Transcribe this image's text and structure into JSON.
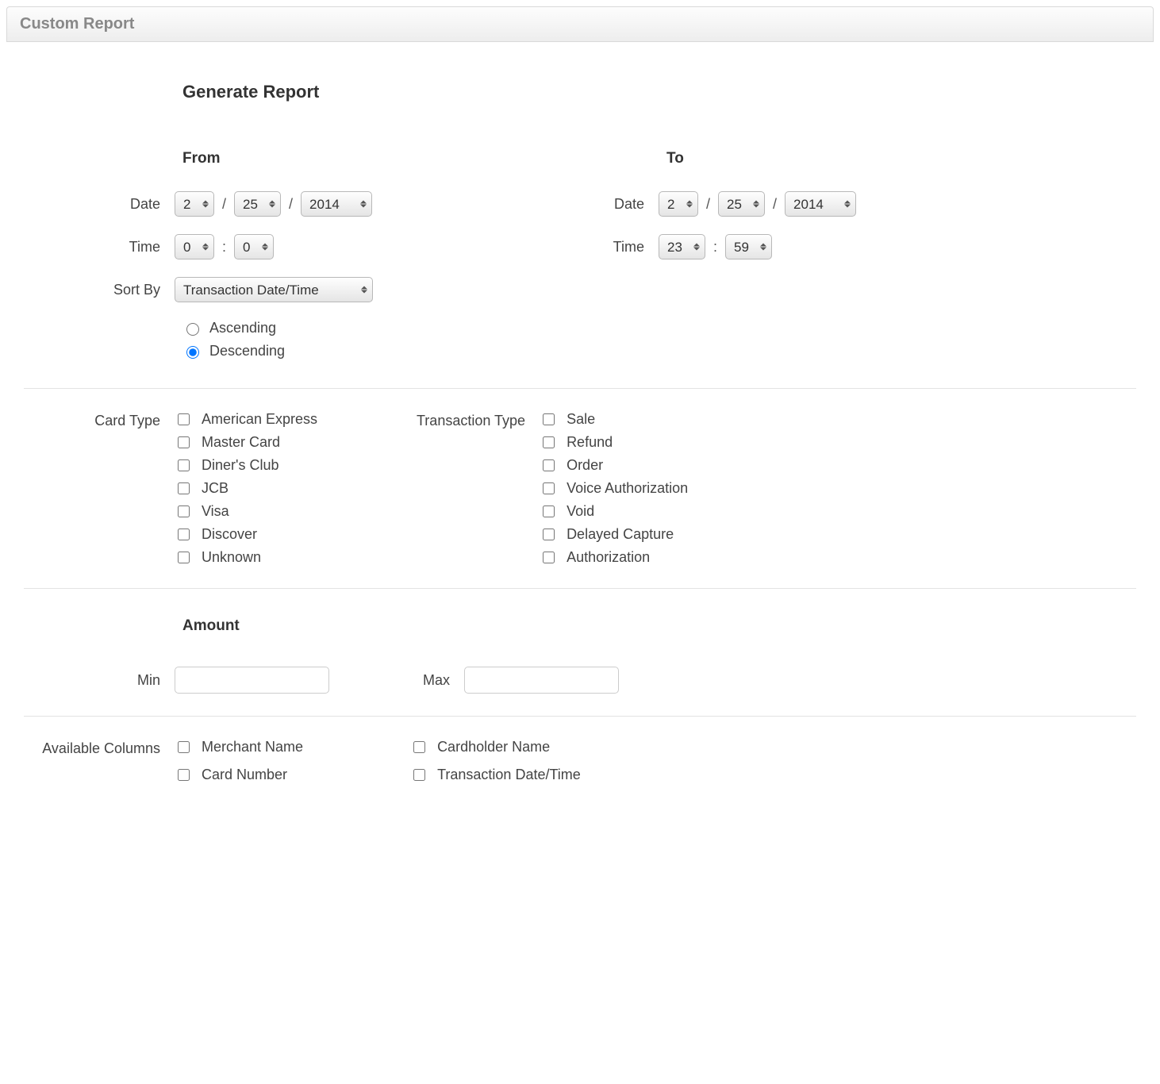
{
  "header": {
    "title": "Custom Report"
  },
  "page_title": "Generate Report",
  "from": {
    "label": "From",
    "date_label": "Date",
    "time_label": "Time",
    "month": "2",
    "day": "25",
    "year": "2014",
    "hour": "0",
    "minute": "0"
  },
  "to": {
    "label": "To",
    "date_label": "Date",
    "time_label": "Time",
    "month": "2",
    "day": "25",
    "year": "2014",
    "hour": "23",
    "minute": "59"
  },
  "sort": {
    "label": "Sort By",
    "value": "Transaction Date/Time",
    "asc_label": "Ascending",
    "desc_label": "Descending",
    "selected": "desc"
  },
  "card_type": {
    "label": "Card Type",
    "items": [
      "American Express",
      "Master Card",
      "Diner's Club",
      "JCB",
      "Visa",
      "Discover",
      "Unknown"
    ]
  },
  "transaction_type": {
    "label": "Transaction Type",
    "items": [
      "Sale",
      "Refund",
      "Order",
      "Voice Authorization",
      "Void",
      "Delayed Capture",
      "Authorization"
    ]
  },
  "amount": {
    "title": "Amount",
    "min_label": "Min",
    "max_label": "Max",
    "min_value": "",
    "max_value": ""
  },
  "available_columns": {
    "label": "Available Columns",
    "col1": [
      "Merchant Name",
      "Card Number"
    ],
    "col2": [
      "Cardholder Name",
      "Transaction Date/Time"
    ]
  },
  "separators": {
    "slash": "/",
    "colon": ":"
  }
}
